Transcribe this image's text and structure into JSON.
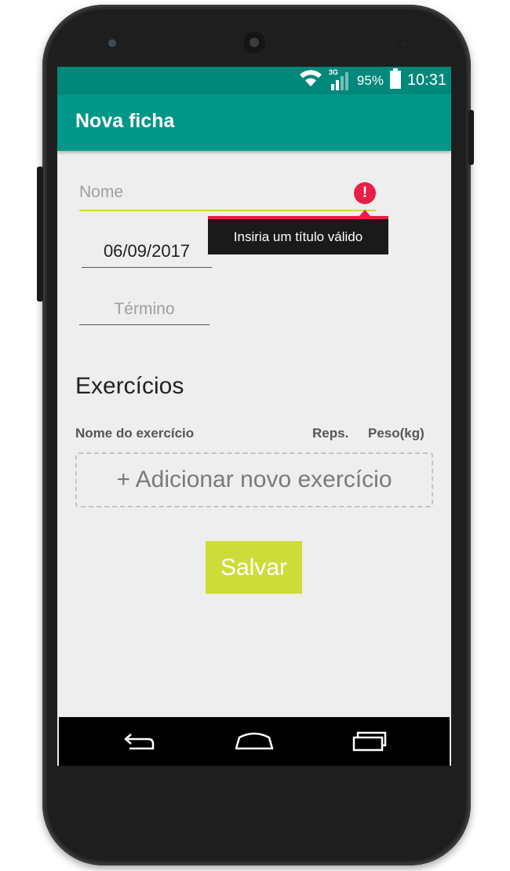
{
  "status_bar": {
    "network": "3G",
    "battery_percent": "95%",
    "time": "10:31"
  },
  "app_bar": {
    "title": "Nova ficha"
  },
  "form": {
    "name_field": {
      "placeholder": "Nome",
      "error_message": "Insiria um título válido"
    },
    "start_date": "06/09/2017",
    "end_date_placeholder": "Término"
  },
  "exercises": {
    "title": "Exercícios",
    "columns": [
      "Nome do exercício",
      "Reps.",
      "Peso(kg)"
    ],
    "add_label": "+ Adicionar novo exercício"
  },
  "save_button": "Salvar",
  "icons": {
    "wifi": "wifi-icon",
    "signal": "signal-icon",
    "battery": "battery-icon",
    "error": "error-icon",
    "back": "back-icon",
    "home": "home-icon",
    "recents": "recents-icon"
  },
  "colors": {
    "primary": "#009688",
    "status_bar": "#00897b",
    "accent": "#cddc39",
    "error": "#e91e45",
    "background": "#eeeeee"
  }
}
